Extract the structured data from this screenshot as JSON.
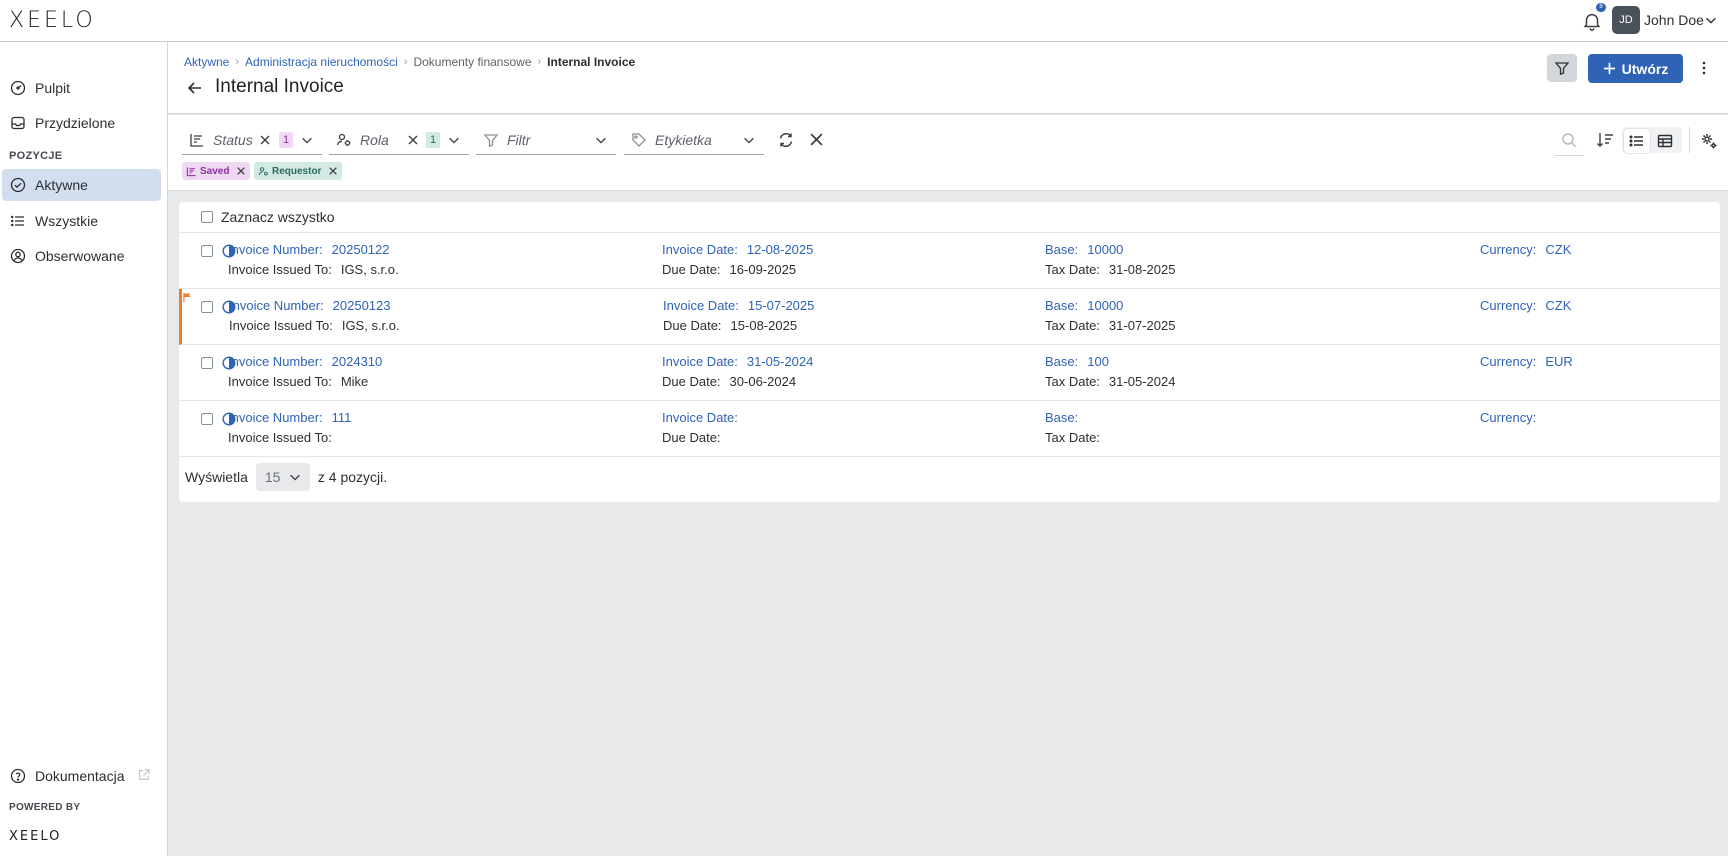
{
  "app": {
    "logo": "XEELO",
    "notifications_count": "8",
    "user_initials": "JD",
    "user_name": "John Doe"
  },
  "sidebar": {
    "items_top": [
      {
        "label": "Pulpit",
        "icon": "gauge-icon"
      },
      {
        "label": "Przydzielone",
        "icon": "inbox-icon"
      }
    ],
    "section_label": "POZYCJE",
    "items_section": [
      {
        "label": "Aktywne",
        "icon": "check-circle-icon",
        "active": true
      },
      {
        "label": "Wszystkie",
        "icon": "list-icon"
      },
      {
        "label": "Obserwowane",
        "icon": "user-circle-icon"
      }
    ],
    "docs_label": "Dokumentacja",
    "powered_by": "POWERED BY",
    "powered_logo": "XEELO"
  },
  "header": {
    "breadcrumbs": [
      {
        "label": "Aktywne",
        "type": "link"
      },
      {
        "label": "Administracja nieruchomości",
        "type": "link"
      },
      {
        "label": "Dokumenty finansowe",
        "type": "plain"
      },
      {
        "label": "Internal Invoice",
        "type": "current"
      }
    ],
    "title": "Internal Invoice",
    "create_label": "Utwórz"
  },
  "filters": {
    "status": {
      "placeholder": "Status",
      "count": "1"
    },
    "role": {
      "placeholder": "Rola",
      "count": "1"
    },
    "filter": {
      "placeholder": "Filtr"
    },
    "tag": {
      "placeholder": "Etykietka"
    },
    "chips": [
      {
        "label": "Saved",
        "icon": "status-icon"
      },
      {
        "label": "Requestor",
        "icon": "user-role-icon"
      }
    ]
  },
  "list": {
    "select_all": "Zaznacz wszystko",
    "labels": {
      "invoice_number": "Invoice Number:",
      "issued_to": "Invoice Issued To:",
      "invoice_date": "Invoice Date:",
      "due_date": "Due Date:",
      "base": "Base:",
      "tax_date": "Tax Date:",
      "currency": "Currency:"
    },
    "rows": [
      {
        "invoice_number": "20250122",
        "issued_to": "IGS, s.r.o.",
        "invoice_date": "12-08-2025",
        "due_date": "16-09-2025",
        "base": "10000",
        "tax_date": "31-08-2025",
        "currency": "CZK",
        "flagged": false
      },
      {
        "invoice_number": "20250123",
        "issued_to": "IGS, s.r.o.",
        "invoice_date": "15-07-2025",
        "due_date": "15-08-2025",
        "base": "10000",
        "tax_date": "31-07-2025",
        "currency": "CZK",
        "flagged": true
      },
      {
        "invoice_number": "2024310",
        "issued_to": "Mike",
        "invoice_date": "31-05-2024",
        "due_date": "30-06-2024",
        "base": "100",
        "tax_date": "31-05-2024",
        "currency": "EUR",
        "flagged": false
      },
      {
        "invoice_number": "111",
        "issued_to": "",
        "invoice_date": "",
        "due_date": "",
        "base": "",
        "tax_date": "",
        "currency": "",
        "flagged": false
      }
    ]
  },
  "pager": {
    "prefix": "Wyświetla",
    "page_size": "15",
    "suffix": "z 4 pozycji."
  },
  "colors": {
    "accent": "#2f63b5",
    "flag": "#ef7d2d",
    "active_nav": "#d2deee"
  }
}
